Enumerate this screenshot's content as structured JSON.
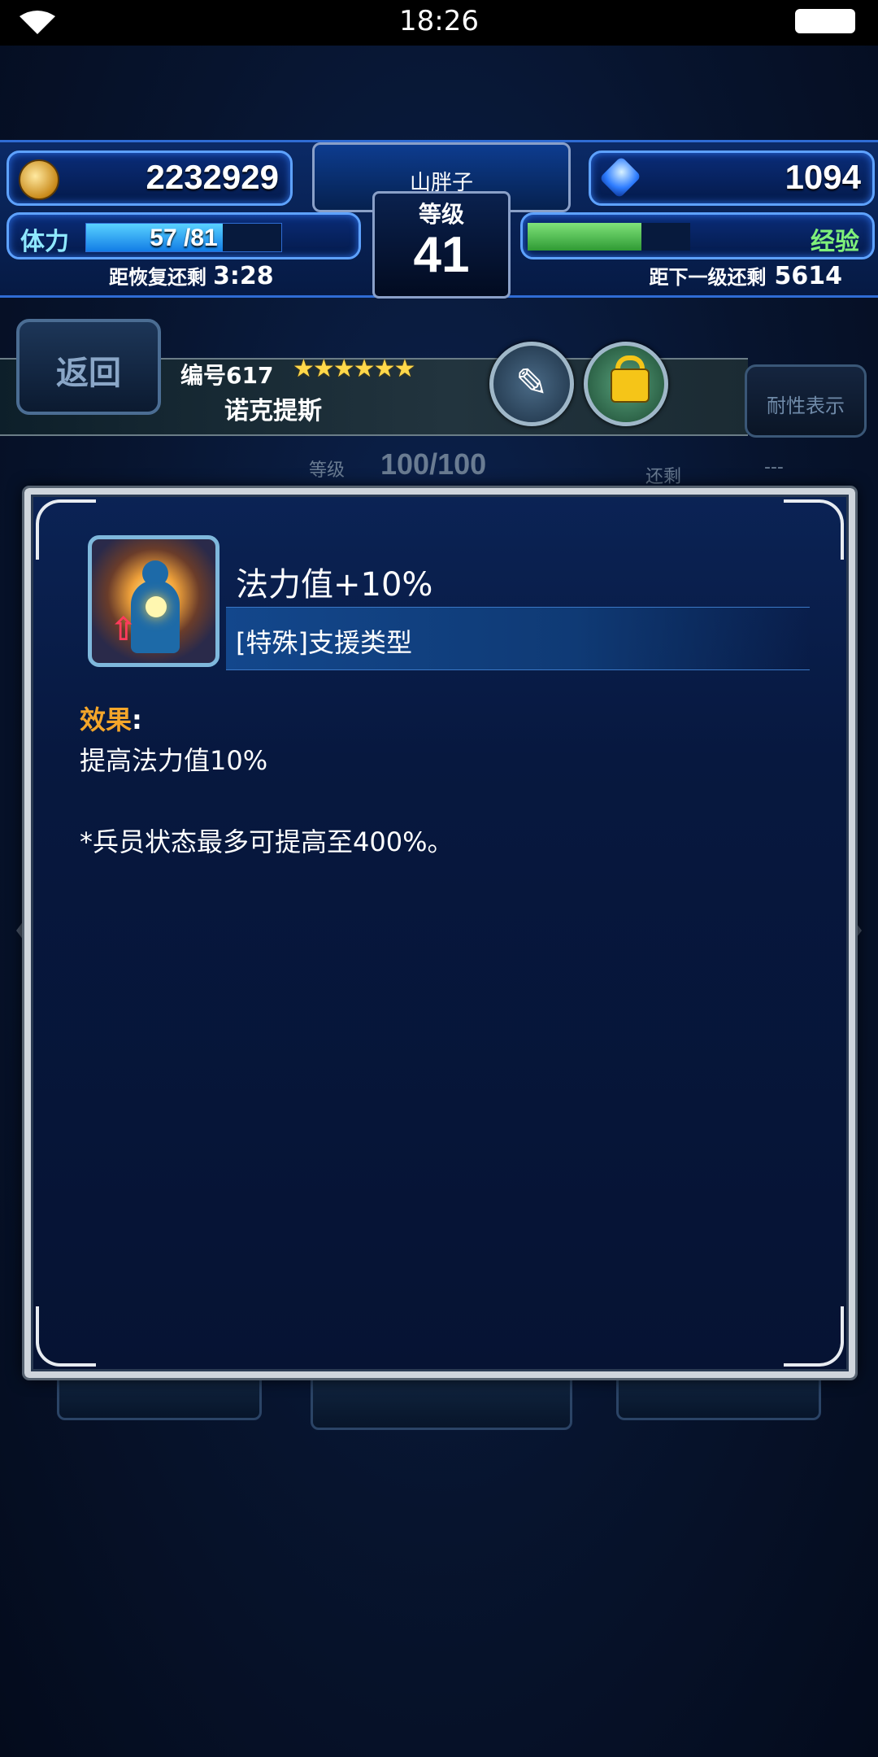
{
  "status_bar": {
    "time": "18:26"
  },
  "hud": {
    "gil": "2232929",
    "gems": "1094",
    "player_name": "山胖子",
    "level_label": "等级",
    "level": "41",
    "stamina_label": "体力",
    "stamina": "57 /81",
    "stamina_fraction": 0.7,
    "exp_label": "经验",
    "exp_fraction": 0.7,
    "recover_label": "距恢复还剩",
    "recover_time": "3:28",
    "next_level_label": "距下一级还剩",
    "next_level_exp": "5614"
  },
  "character": {
    "back_label": "返回",
    "number": "编号617",
    "stars": "★★★★★★",
    "name": "诺克提斯",
    "durability_label": "耐性表示"
  },
  "behind": {
    "level_label": "等级",
    "level_value": "100/100",
    "remain_label": "还剩",
    "remain_value": "---"
  },
  "modal": {
    "ability_title": "法力值+10%",
    "ability_type": "[特殊]支援类型",
    "effect_label": "效果",
    "effect_colon": ":",
    "effect_text": "提高法力值10%",
    "note_text": "*兵员状态最多可提高至400%。"
  },
  "colors": {
    "effect_label": "#f4a62a",
    "stamina_fill": "#127de6",
    "exp_fill": "#2f9b34"
  }
}
